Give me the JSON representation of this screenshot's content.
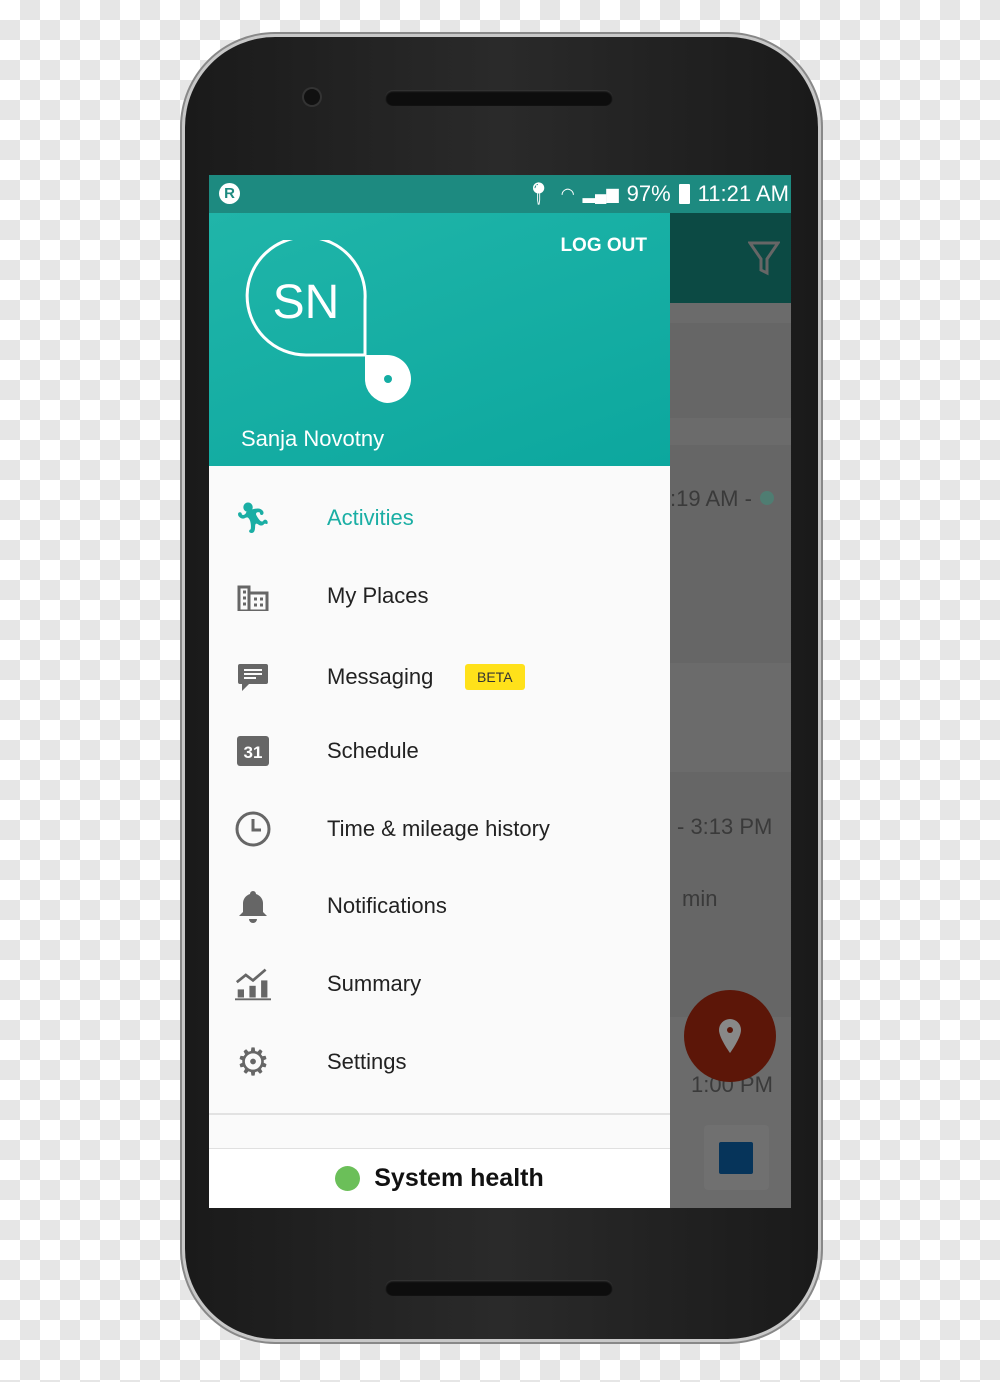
{
  "status_bar": {
    "battery": "97%",
    "time": "11:21 AM",
    "app_icon": "r-logo-icon"
  },
  "drawer": {
    "header": {
      "initials": "SN",
      "user_name": "Sanja Novotny",
      "logout_label": "LOG OUT",
      "color": "#14ada3"
    },
    "items": [
      {
        "label": "Activities",
        "icon": "running-icon",
        "active": true
      },
      {
        "label": "My Places",
        "icon": "buildings-icon"
      },
      {
        "label": "Messaging",
        "icon": "chat-icon",
        "badge": "BETA"
      },
      {
        "label": "Schedule",
        "icon": "calendar-icon",
        "icon_text": "31"
      },
      {
        "label": "Time & mileage history",
        "icon": "clock-icon"
      },
      {
        "label": "Notifications",
        "icon": "bell-icon"
      },
      {
        "label": "Summary",
        "icon": "chart-icon"
      },
      {
        "label": "Settings",
        "icon": "gear-icon"
      }
    ],
    "system_health": {
      "label": "System health",
      "status_color": "#6bbf59"
    }
  },
  "background": {
    "texts": [
      ":19 AM -",
      "- 3:13 PM",
      "min",
      "1:00 PM"
    ]
  },
  "colors": {
    "accent": "#1aaea4",
    "active_text": "#1aaea4",
    "fab": "#c22e10"
  }
}
